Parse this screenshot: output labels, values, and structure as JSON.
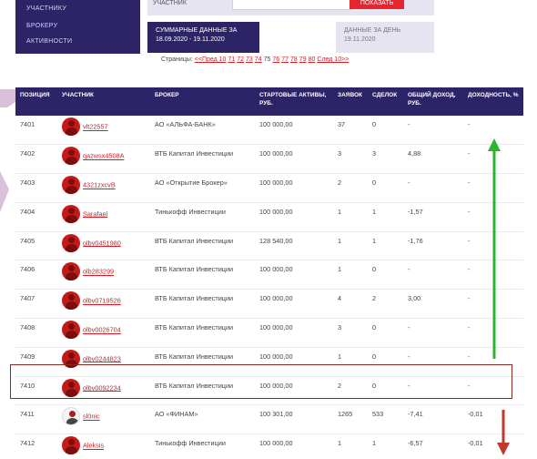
{
  "side_menu": {
    "items": [
      "УЧАСТНИКУ",
      "БРОКЕРУ",
      "АКТИВНОСТИ"
    ]
  },
  "filter": {
    "label": "УЧАСТНИК",
    "input_value": "",
    "show_button": "ПОКАЗАТЬ"
  },
  "tabs": {
    "summary": {
      "line1": "СУММАРНЫЕ ДАННЫЕ ЗА",
      "line2": "18.09.2020 - 19.11.2020"
    },
    "daily": {
      "line1": "ДАННЫЕ ЗА ДЕНЬ",
      "line2": "19.11.2020"
    }
  },
  "pager": {
    "label": "Страницы:",
    "prev": "<<Пред 10",
    "pages": [
      "71",
      "72",
      "73",
      "74",
      "75",
      "76",
      "77",
      "78",
      "79",
      "80"
    ],
    "current": "75",
    "next": "След 10>>"
  },
  "table": {
    "headers": [
      "ПОЗИЦИЯ",
      "УЧАСТНИК",
      "БРОКЕР",
      "СТАРТОВЫЕ АКТИВЫ, РУБ.",
      "ЗАЯВОК",
      "СДЕЛОК",
      "ОБЩИЙ ДОХОД, РУБ.",
      "ДОХОДНОСТЬ, %"
    ],
    "rows": [
      {
        "pos": "7401",
        "user": "vlt22557",
        "broker": "АО «АЛЬФА-БАНК»",
        "assets": "100 000,00",
        "orders": "37",
        "deals": "0",
        "income": "-",
        "yield": "-"
      },
      {
        "pos": "7402",
        "user": "qazwsx4508A",
        "broker": "ВТБ Капитал Инвестиции",
        "assets": "100 000,00",
        "orders": "3",
        "deals": "3",
        "income": "4,88",
        "yield": "-"
      },
      {
        "pos": "7403",
        "user": "4321zxcvB",
        "broker": "АО «Открытие Брокер»",
        "assets": "100 000,00",
        "orders": "2",
        "deals": "0",
        "income": "-",
        "yield": "-"
      },
      {
        "pos": "7404",
        "user": "Sarafael",
        "broker": "Тинькофф Инвестиции",
        "assets": "100 000,00",
        "orders": "1",
        "deals": "1",
        "income": "-1,57",
        "yield": "-"
      },
      {
        "pos": "7405",
        "user": "olbv0451980",
        "broker": "ВТБ Капитал Инвестиции",
        "assets": "128 540,00",
        "orders": "1",
        "deals": "1",
        "income": "-1,76",
        "yield": "-"
      },
      {
        "pos": "7406",
        "user": "olb283299",
        "broker": "ВТБ Капитал Инвестиции",
        "assets": "100 000,00",
        "orders": "1",
        "deals": "0",
        "income": "-",
        "yield": "-"
      },
      {
        "pos": "7407",
        "user": "olbv0719526",
        "broker": "ВТБ Капитал Инвестиции",
        "assets": "100 000,00",
        "orders": "4",
        "deals": "2",
        "income": "3,00",
        "yield": "-"
      },
      {
        "pos": "7408",
        "user": "olbv0026704",
        "broker": "ВТБ Капитал Инвестиции",
        "assets": "100 000,00",
        "orders": "3",
        "deals": "0",
        "income": "-",
        "yield": "-"
      },
      {
        "pos": "7409",
        "user": "olbv0244823",
        "broker": "ВТБ Капитал Инвестиции",
        "assets": "100 000,00",
        "orders": "1",
        "deals": "0",
        "income": "-",
        "yield": "-"
      },
      {
        "pos": "7410",
        "user": "olbv0092234",
        "broker": "ВТБ Капитал Инвестиции",
        "assets": "100 000,00",
        "orders": "2",
        "deals": "0",
        "income": "-",
        "yield": "-"
      },
      {
        "pos": "7411",
        "user": "sl0nic",
        "broker": "АО «ФИНАМ»",
        "assets": "100 301,00",
        "orders": "1265",
        "deals": "533",
        "income": "-7,41",
        "yield": "-0,01"
      },
      {
        "pos": "7412",
        "user": "Aleksis",
        "broker": "Тинькофф Инвестиции",
        "assets": "100 000,00",
        "orders": "1",
        "deals": "1",
        "income": "-6,57",
        "yield": "-0,01"
      }
    ]
  },
  "colors": {
    "brand": "#2c2467",
    "accent": "#d0202a",
    "highlight_box": "#8b2a20",
    "up_arrow": "#2db42d",
    "down_arrow": "#c0392b"
  }
}
